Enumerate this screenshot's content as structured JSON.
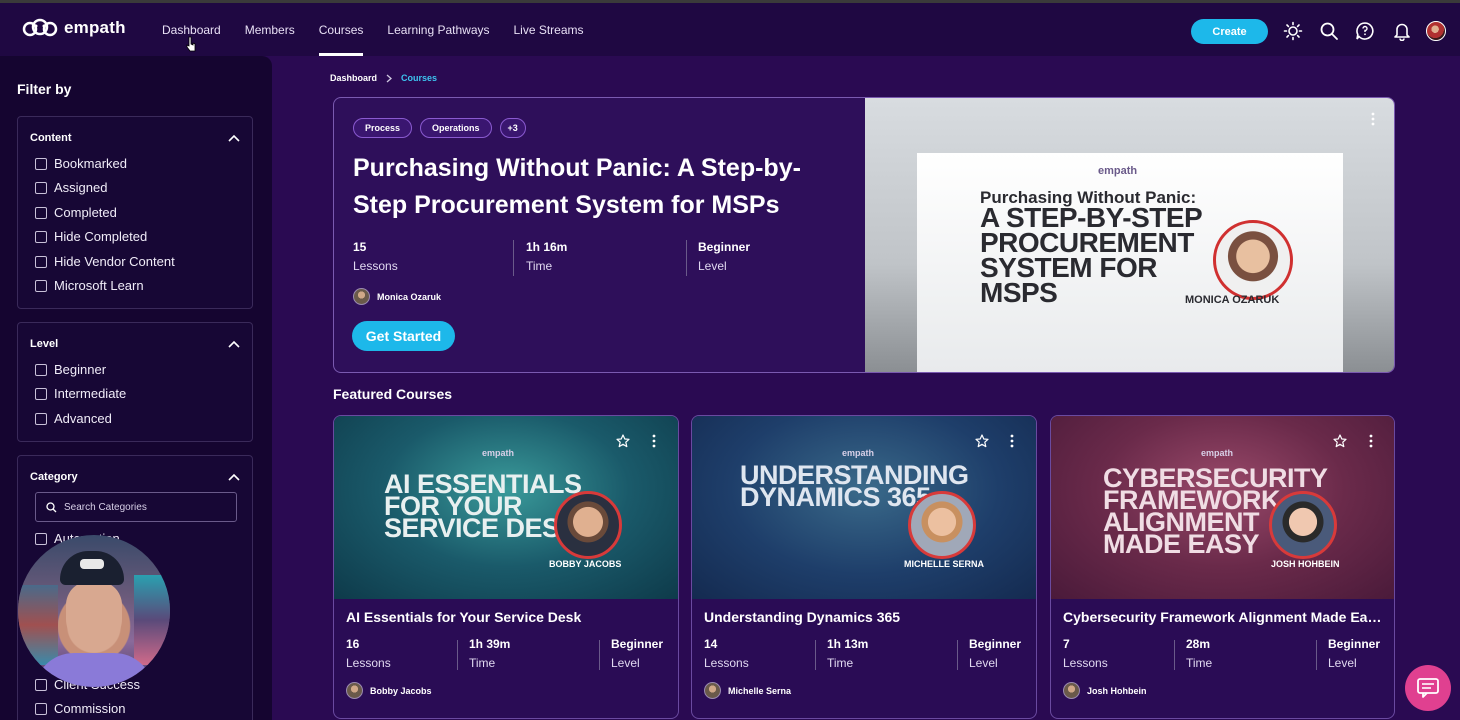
{
  "brand": {
    "name": "empath"
  },
  "nav": {
    "items": [
      {
        "label": "Dashboard"
      },
      {
        "label": "Members"
      },
      {
        "label": "Courses"
      },
      {
        "label": "Learning Pathways"
      },
      {
        "label": "Live Streams"
      }
    ],
    "active": "Courses",
    "create_label": "Create"
  },
  "sidebar": {
    "title": "Filter by",
    "content": {
      "heading": "Content",
      "options": [
        "Bookmarked",
        "Assigned",
        "Completed",
        "Hide Completed",
        "Hide Vendor Content",
        "Microsoft Learn"
      ]
    },
    "level": {
      "heading": "Level",
      "options": [
        "Beginner",
        "Intermediate",
        "Advanced"
      ]
    },
    "category": {
      "heading": "Category",
      "search_placeholder": "Search Categories",
      "options": [
        "Automation",
        "Client Success",
        "Commission"
      ]
    }
  },
  "breadcrumb": {
    "home": "Dashboard",
    "current": "Courses"
  },
  "hero": {
    "tags": [
      "Process",
      "Operations",
      "+3"
    ],
    "title": "Purchasing Without Panic: A Step-by-Step Procurement System for MSPs",
    "stats": [
      {
        "value": "15",
        "label": "Lessons"
      },
      {
        "value": "1h 16m",
        "label": "Time"
      },
      {
        "value": "Beginner",
        "label": "Level"
      }
    ],
    "author": "Monica Ozaruk",
    "cta": "Get Started",
    "image": {
      "brand": "empath",
      "headline_top": "Purchasing Without Panic:",
      "headline": "A Step-by-Step Procurement System for MSPs",
      "caption": "MONICA OZARUK"
    }
  },
  "featured": {
    "title": "Featured Courses",
    "courses": [
      {
        "title": "AI Essentials for Your Service Desk",
        "image_headline": "AI Essentials for Your Service Desk",
        "image_caption": "BOBBY JACOBS",
        "stats": [
          {
            "value": "16",
            "label": "Lessons"
          },
          {
            "value": "1h 39m",
            "label": "Time"
          },
          {
            "value": "Beginner",
            "label": "Level"
          }
        ],
        "author": "Bobby Jacobs"
      },
      {
        "title": "Understanding Dynamics 365",
        "image_headline": "Understanding Dynamics 365",
        "image_caption": "MICHELLE SERNA",
        "stats": [
          {
            "value": "14",
            "label": "Lessons"
          },
          {
            "value": "1h 13m",
            "label": "Time"
          },
          {
            "value": "Beginner",
            "label": "Level"
          }
        ],
        "author": "Michelle Serna"
      },
      {
        "title": "Cybersecurity Framework Alignment Made Easy",
        "image_headline": "Cybersecurity Framework Alignment Made Easy",
        "image_caption": "JOSH HOHBEIN",
        "stats": [
          {
            "value": "7",
            "label": "Lessons"
          },
          {
            "value": "28m",
            "label": "Time"
          },
          {
            "value": "Beginner",
            "label": "Level"
          }
        ],
        "author": "Josh Hohbein"
      }
    ]
  },
  "colors": {
    "accent": "#1db8ea",
    "background": "#2a0a52",
    "topbar": "#1f0842",
    "sidebar": "#150530",
    "chat": "#e04090"
  },
  "icons": [
    "theme-sun-icon",
    "search-icon",
    "chat-icon",
    "bell-icon",
    "user-avatar",
    "star-icon",
    "kebab-icon",
    "chevron-up-icon",
    "chevron-right-icon"
  ]
}
